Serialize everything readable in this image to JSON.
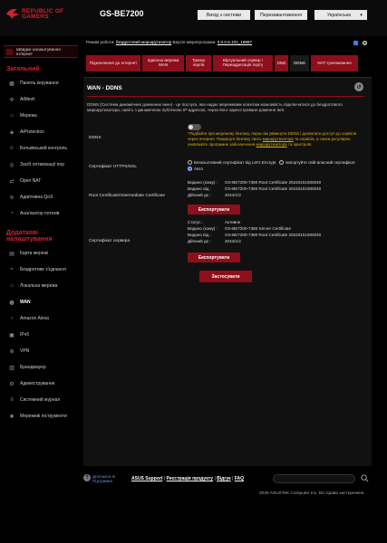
{
  "header": {
    "brand_line1": "REPUBLIC OF",
    "brand_line2": "GAMERS",
    "model": "GS-BE7200",
    "logout": "Вихід з системи",
    "reboot": "Перезавантаження",
    "language": "Українська"
  },
  "statusline": {
    "mode_label": "Режим роботи:",
    "mode_value": "бездротовий маршрутизатор",
    "fw_label": "Версія мікропрограми:",
    "fw_value": "3.0.0.6.102_18897"
  },
  "sidebar": {
    "quick": "Швидке налаштування Інтернет",
    "general_title": "Загальний",
    "general": [
      {
        "label": "Панель керування",
        "icon": "dashboard-icon"
      },
      {
        "label": "AiMesh",
        "icon": "mesh-icon"
      },
      {
        "label": "Мережа",
        "icon": "network-icon"
      },
      {
        "label": "AiProtection",
        "icon": "shield-icon"
      },
      {
        "label": "Батьківський контроль",
        "icon": "parental-icon"
      },
      {
        "label": "Засіб оптимізації ігор",
        "icon": "game-icon"
      },
      {
        "label": "Open NAT",
        "icon": "nat-icon"
      },
      {
        "label": "Адаптивна QoS",
        "icon": "qos-icon"
      },
      {
        "label": "Аналізатор потоків",
        "icon": "analyzer-icon"
      }
    ],
    "advanced_title": "Додаткові налаштування",
    "advanced": [
      {
        "label": "Карта мережі",
        "icon": "map-icon"
      },
      {
        "label": "Бездротове з'єднання",
        "icon": "wifi-icon"
      },
      {
        "label": "Локальна мережа",
        "icon": "lan-icon"
      },
      {
        "label": "WAN",
        "icon": "globe-icon"
      },
      {
        "label": "Amazon Alexa",
        "icon": "alexa-icon"
      },
      {
        "label": "IPv6",
        "icon": "ipv6-icon"
      },
      {
        "label": "VPN",
        "icon": "vpn-icon"
      },
      {
        "label": "Брандмауер",
        "icon": "firewall-icon"
      },
      {
        "label": "Адміністрування",
        "icon": "admin-icon"
      },
      {
        "label": "Системний журнал",
        "icon": "log-icon"
      },
      {
        "label": "Мережеві інструменти",
        "icon": "tools-icon"
      }
    ]
  },
  "tabs": [
    "Підключення до Інтернет",
    "Здвоєна мережа WAN",
    "Тригер портів",
    "Віртуальний сервер / Переадресація порту",
    "DMZ",
    "DDNS",
    "NAT-тунелювання"
  ],
  "panel": {
    "title": "WAN - DDNS",
    "description": "DDNS (Система динамічних доменних імен) - це послуга, яка надає мережевим клієнтам можливість підключатися до бездротового маршрутизатора, навіть з динамічною публічною IP-адресою, через його зареєстроване доменне ім'я.",
    "ddns_label": "DDNS",
    "note": "*Подбайте про мережеву безпеку, перш ніж увімкнути DDNS і дозволити доступ до сервісів через Інтернет. Покращте безпеку свого",
    "note_link1": "маршрутизатора",
    "note_mid": "та сервісів, а також регулярно оновлюйте програмне забезпечення",
    "note_link2": "маршрутизатора",
    "note_end": "та пристроїв.",
    "https_label": "Сертифікат HTTPS/SSL",
    "https_opt1": "Безкоштовний сертифікат від Let's Encrypt",
    "https_opt2": "Імпортуйте свій власний сертифікат",
    "https_opt3": "Авто",
    "root_label": "Root Certificate/Intermediate Certificate",
    "root_issued_to_k": "Видано (кому) :",
    "root_issued_to_v": "GS-BE7200-7380 Root Certificate 20240101000040",
    "root_issued_by_k": "Видано від :",
    "root_issued_by_v": "GS-BE7200-7380 Root Certificate 20240101000040",
    "root_valid_k": "Дійсний до :",
    "root_valid_v": "2044/1/2",
    "export": "Експортувати",
    "server_label": "Сертифікат сервера",
    "srv_status_k": "Статус :",
    "srv_status_v": "Активне",
    "srv_issued_to_k": "Видано (кому) :",
    "srv_issued_to_v": "GS-BE7200-7380 Server Certificate",
    "srv_issued_by_k": "Видано від :",
    "srv_issued_by_v": "GS-BE7200-7380 Root Certificate 20240101000040",
    "srv_valid_k": "Дійсний до :",
    "srv_valid_v": "2044/1/2",
    "apply": "Застосувати"
  },
  "footer": {
    "help": "Допомога & Підтримка",
    "asus_support": "ASUS Support",
    "registration": "Реєстрація продукту",
    "feedback": "Відгук",
    "faq": "FAQ",
    "copyright": "2026 ASUSTeK Computer Inc. Всі права застережені."
  }
}
